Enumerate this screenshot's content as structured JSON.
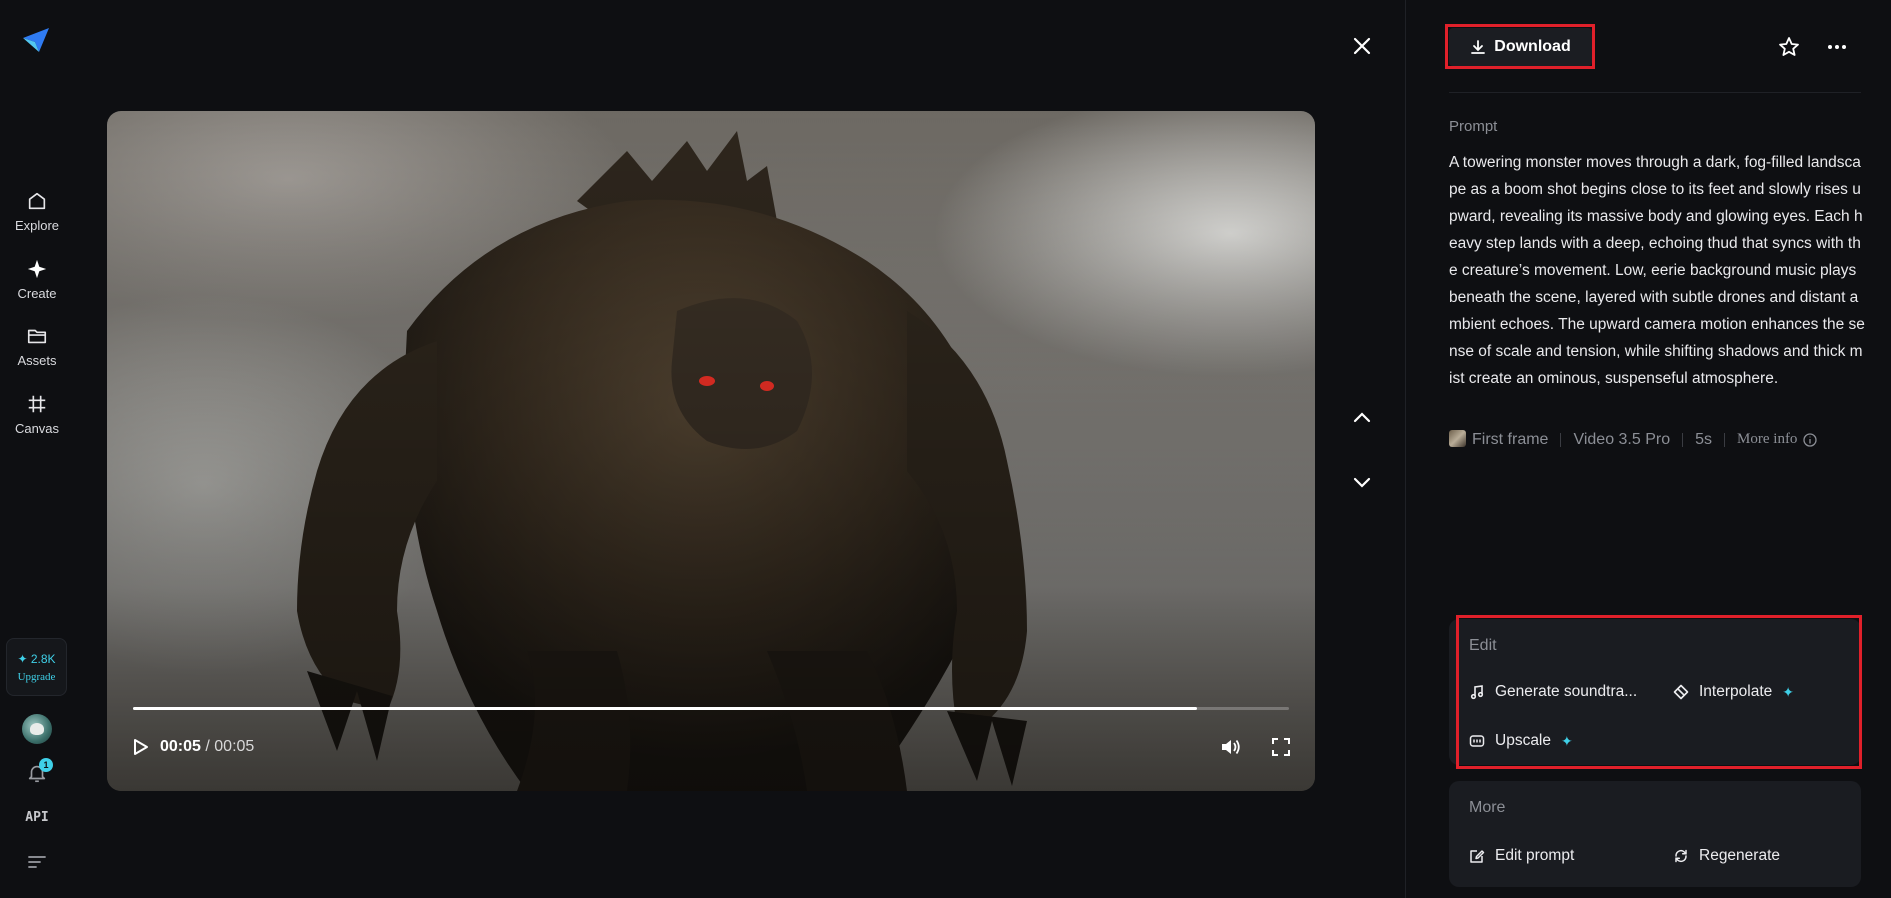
{
  "sidebar": {
    "logo": "paper-plane-logo",
    "items": [
      {
        "label": "Explore",
        "icon": "home-icon"
      },
      {
        "label": "Create",
        "icon": "sparkle-icon"
      },
      {
        "label": "Assets",
        "icon": "folder-icon"
      },
      {
        "label": "Canvas",
        "icon": "canvas-icon"
      }
    ],
    "credits": {
      "amount": "✦ 2.8K",
      "upgrade_label": "Upgrade"
    },
    "notification_count": "1",
    "api_label": "API"
  },
  "player": {
    "current_time": "00:05",
    "total_time": "/ 00:05",
    "progress": 0.92
  },
  "actions": {
    "download_label": "Download"
  },
  "details": {
    "prompt_label": "Prompt",
    "prompt_text": "A towering monster moves through a dark, fog-filled landscape as a boom shot begins close to its feet and slowly rises upward, revealing its massive body and glowing eyes. Each heavy step lands with a deep, echoing thud that syncs with the creature’s movement. Low, eerie background music plays beneath the scene, layered with subtle drones and distant ambient echoes. The upward camera motion enhances the sense of scale and tension, while shifting shadows and thick mist create an ominous, suspenseful atmosphere.",
    "meta": {
      "first_frame": "First frame",
      "model": "Video 3.5 Pro",
      "duration": "5s",
      "more_info": "More info"
    }
  },
  "edit_card": {
    "title": "Edit",
    "items": [
      {
        "label": "Generate soundtra..."
      },
      {
        "label": "Interpolate"
      },
      {
        "label": "Upscale"
      }
    ]
  },
  "more_card": {
    "title": "More",
    "items": [
      {
        "label": "Edit prompt"
      },
      {
        "label": "Regenerate"
      }
    ]
  },
  "colors": {
    "accent": "#3fd0e8",
    "highlight": "#e0202a",
    "background": "#0e0f12",
    "card": "#1a1c21"
  }
}
